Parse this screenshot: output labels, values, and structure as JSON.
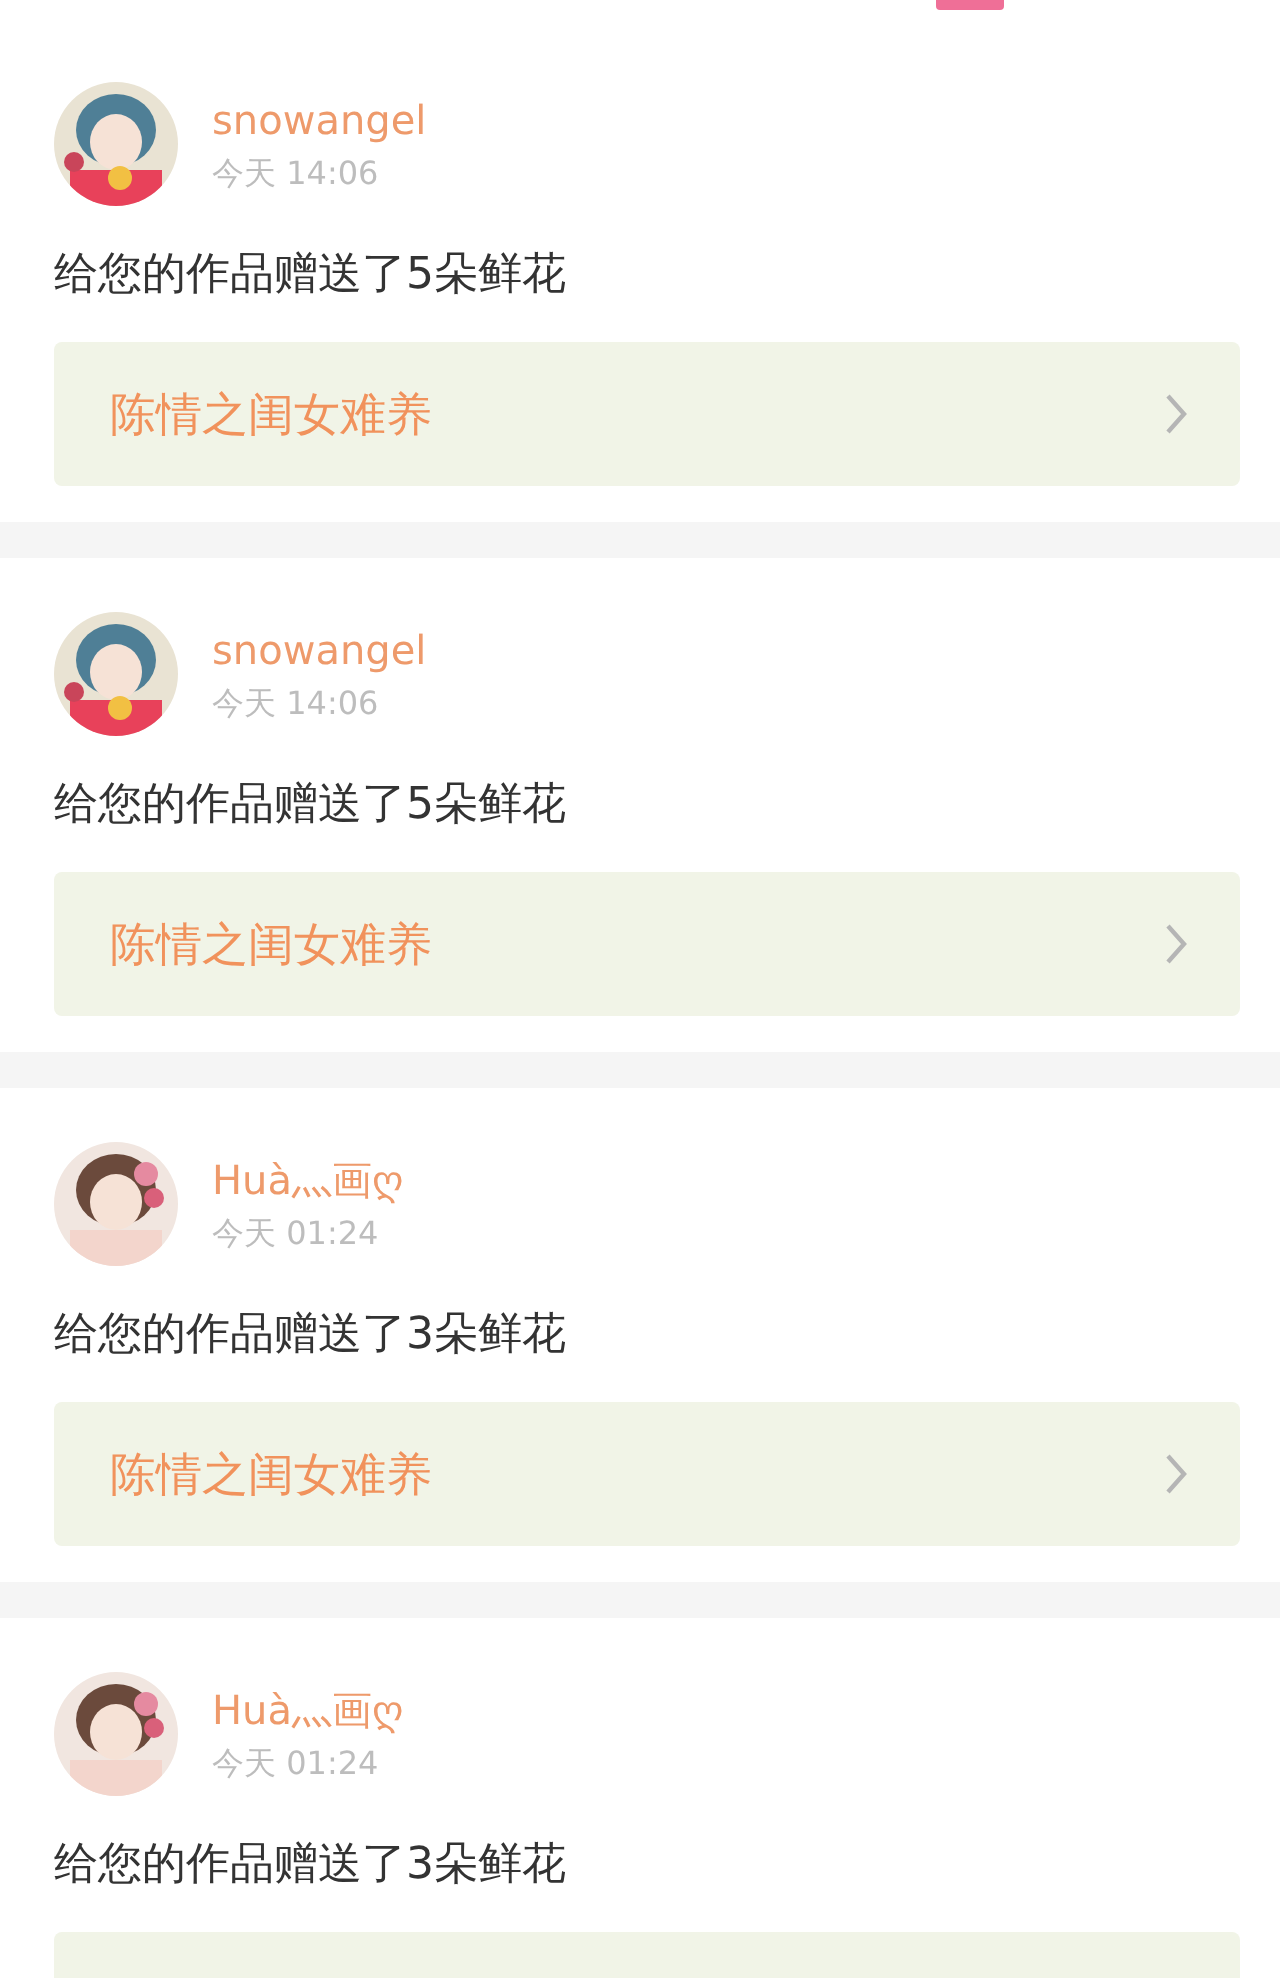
{
  "top_tabs": {
    "active_indicator": true
  },
  "notifications": [
    {
      "user": "snowangel",
      "time": "今天 14:06",
      "message": "给您的作品赠送了5朵鲜花",
      "book": {
        "title": "陈情之闺女难养"
      }
    },
    {
      "user": "snowangel",
      "time": "今天 14:06",
      "message": "给您的作品赠送了5朵鲜花",
      "book": {
        "title": "陈情之闺女难养"
      }
    },
    {
      "user": "Huà灬画ღ",
      "time": "今天 01:24",
      "message": "给您的作品赠送了3朵鲜花",
      "book": {
        "title": "陈情之闺女难养"
      }
    },
    {
      "user": "Huà灬画ღ",
      "time": "今天 01:24",
      "message": "给您的作品赠送了3朵鲜花",
      "book_card_partial": true
    }
  ]
}
